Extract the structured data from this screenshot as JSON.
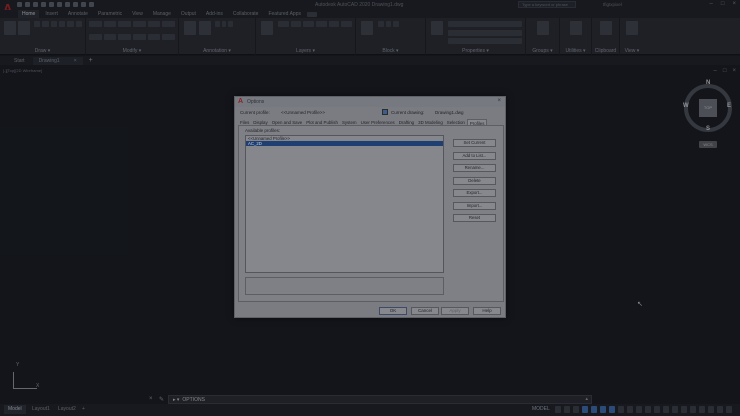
{
  "titlebar": {
    "logo": "A",
    "title": "Autodesk AutoCAD 2020   Drawing1.dwg",
    "search_placeholder": "Type a keyword or phrase",
    "user": "tfigtxpixel"
  },
  "ribbon": {
    "tabs": [
      "Home",
      "Insert",
      "Annotate",
      "Parametric",
      "View",
      "Manage",
      "Output",
      "Add-ins",
      "Collaborate",
      "Featured Apps"
    ],
    "panels": [
      "Draw ▾",
      "Modify ▾",
      "Annotation ▾",
      "Layers ▾",
      "Block ▾",
      "Properties ▾",
      "Groups ▾",
      "Utilities ▾",
      "Clipboard",
      "View ▾"
    ]
  },
  "doctabs": {
    "tabs": [
      "Start",
      "Drawing1"
    ],
    "close": "×",
    "new": "+"
  },
  "canvas": {
    "view_label": "[-][Top][2D Wireframe]",
    "viewcube": {
      "face": "TOP",
      "n": "N",
      "s": "S",
      "e": "E",
      "w": "W",
      "wcs": "WCS"
    },
    "ucs_x": "X",
    "ucs_y": "Y",
    "cursor": "↖"
  },
  "cmdline": {
    "close": "×",
    "wrench": "✎",
    "arrow": "▸ ▾",
    "prompt": "OPTIONS",
    "up": "▴"
  },
  "statusbar": {
    "tabs": [
      "Model",
      "Layout1",
      "Layout2",
      "+"
    ],
    "model": "MODEL"
  },
  "dialog": {
    "logo": "A",
    "title": "Options",
    "close": "×",
    "current_profile_label": "Current profile:",
    "current_profile_value": "<<Unnamed Profile>>",
    "current_drawing_label": "Current drawing:",
    "current_drawing_value": "Drawing1.dwg",
    "tabs": [
      "Files",
      "Display",
      "Open and Save",
      "Plot and Publish",
      "System",
      "User Preferences",
      "Drafting",
      "3D Modeling",
      "Selection",
      "Profiles"
    ],
    "available_label": "Available profiles:",
    "profiles": [
      "<<Unnamed Profile>>",
      "AC_2D"
    ],
    "side_buttons": [
      "Set Current",
      "Add to List...",
      "Rename...",
      "Delete",
      "Export...",
      "Import...",
      "Reset"
    ],
    "footer_buttons": [
      "OK",
      "Cancel",
      "Apply",
      "Help"
    ]
  }
}
